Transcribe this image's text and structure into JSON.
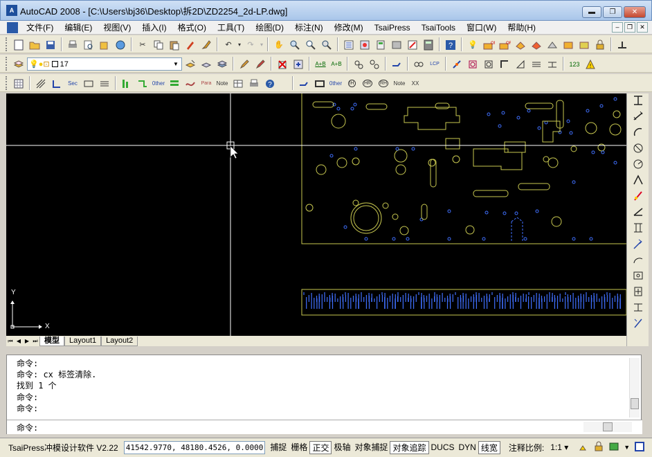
{
  "window": {
    "app_icon": "A",
    "title": "AutoCAD 2008 - [C:\\Users\\bj36\\Desktop\\拆2D\\ZD2254_2d-LP.dwg]",
    "minimize": "▬",
    "maximize": "❐",
    "close": "✕"
  },
  "menu": {
    "items": [
      "文件(F)",
      "编辑(E)",
      "视图(V)",
      "插入(I)",
      "格式(O)",
      "工具(T)",
      "绘图(D)",
      "标注(N)",
      "修改(M)",
      "TsaiPress",
      "TsaiTools",
      "窗口(W)",
      "帮助(H)"
    ],
    "doc_minimize": "–",
    "doc_restore": "❐",
    "doc_close": "✕"
  },
  "layer": {
    "current": "17"
  },
  "toolbar_text": {
    "ab_top": "A+B",
    "ab_bottom": "A+B",
    "lcp": "LCP",
    "n123": "123",
    "other": "0ther",
    "note": "Note",
    "para": "Para",
    "ih": "IH",
    "hr": "HR",
    "rh": "RH",
    "xx": "XX"
  },
  "canvas": {
    "bg": "#000000",
    "crosshair_color": "#ffffff",
    "drawing_color": "#c8c850",
    "hole_color": "#4070ff",
    "axis_y": "Y",
    "axis_x": "X"
  },
  "tabs": {
    "nav_first": "⏮",
    "nav_prev": "◀",
    "nav_next": "▶",
    "nav_last": "⏭",
    "items": [
      {
        "label": "模型",
        "active": true
      },
      {
        "label": "Layout1",
        "active": false
      },
      {
        "label": "Layout2",
        "active": false
      }
    ]
  },
  "command": {
    "history": [
      "命令:",
      "命令: cx 标签清除.",
      "找到 1 个",
      "命令:",
      "命令:"
    ],
    "prompt": "命令:"
  },
  "status": {
    "program": "TsaiPress冲模设计软件 V2.22",
    "coords": "41542.9770, 48180.4526, 0.0000",
    "toggles": [
      {
        "label": "捕捉",
        "on": false
      },
      {
        "label": "栅格",
        "on": false
      },
      {
        "label": "正交",
        "on": true
      },
      {
        "label": "极轴",
        "on": false
      },
      {
        "label": "对象捕捉",
        "on": false
      },
      {
        "label": "对象追踪",
        "on": true
      },
      {
        "label": "DUCS",
        "on": false
      },
      {
        "label": "DYN",
        "on": false
      },
      {
        "label": "线宽",
        "on": true
      }
    ],
    "annotation_scale_label": "注释比例:",
    "annotation_scale_value": "1:1 ▾"
  }
}
